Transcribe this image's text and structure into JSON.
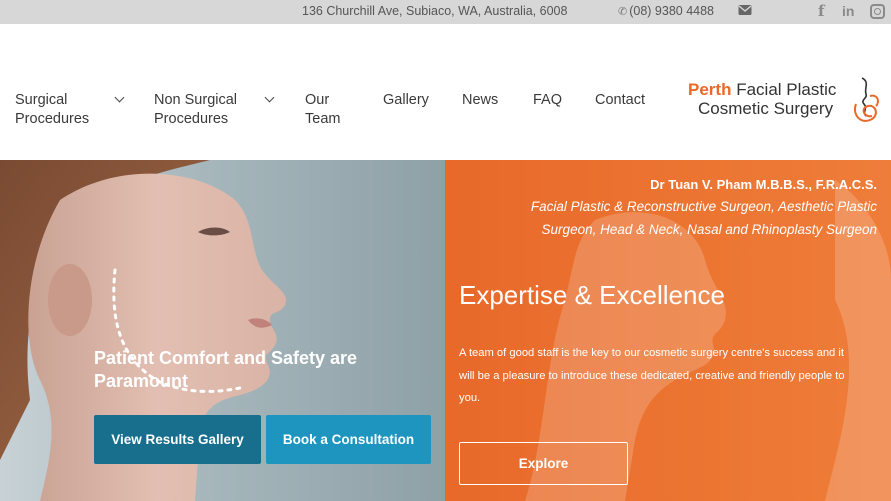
{
  "topbar": {
    "address": "136 Churchill Ave, Subiaco, WA, Australia, 6008",
    "phone": "(08) 9380 4488",
    "phone_icon": "phone-icon",
    "mail_icon": "envelope-icon",
    "social": {
      "facebook": "f",
      "linkedin": "in"
    }
  },
  "nav": {
    "items": [
      {
        "label_line1": "Surgical",
        "label_line2": "Procedures",
        "has_dropdown": true
      },
      {
        "label_line1": "Non Surgical",
        "label_line2": "Procedures",
        "has_dropdown": true
      },
      {
        "label_line1": "Our",
        "label_line2": "Team",
        "has_dropdown": false
      },
      {
        "label_line1": "Gallery",
        "label_line2": "",
        "has_dropdown": false
      },
      {
        "label_line1": "News",
        "label_line2": "",
        "has_dropdown": false
      },
      {
        "label_line1": "FAQ",
        "label_line2": "",
        "has_dropdown": false
      },
      {
        "label_line1": "Contact",
        "label_line2": "",
        "has_dropdown": false
      }
    ]
  },
  "logo": {
    "word1": "Perth",
    "word2": "Facial Plastic",
    "line2": "Cosmetic Surgery"
  },
  "hero_left": {
    "heading": "Patient Comfort and Safety are Paramount",
    "button_gallery": "View Results Gallery",
    "button_consult": "Book a Consultation"
  },
  "hero_right": {
    "doctor_name": "Dr Tuan V. Pham M.B.B.S., F.R.A.C.S.",
    "doctor_title": "Facial Plastic & Reconstructive Surgeon, Aesthetic Plastic Surgeon, Head & Neck, Nasal and Rhinoplasty Surgeon",
    "heading": "Expertise & Excellence",
    "paragraph": "A team of good staff is the key to our cosmetic surgery centre's success and it will be a pleasure to introduce these dedicated, creative and friendly people to you.",
    "button_explore": "Explore"
  },
  "colors": {
    "accent_orange": "#e8692a",
    "button_dark_blue": "#176f8d",
    "button_light_blue": "#1e95be",
    "topbar_bg": "#d7d7d7"
  }
}
